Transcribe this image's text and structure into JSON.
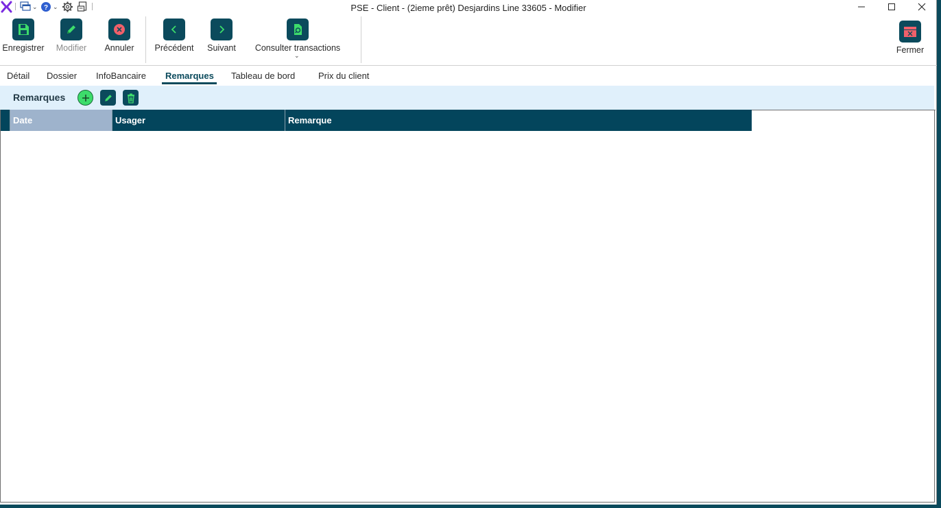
{
  "window": {
    "title": "PSE - Client - (2ieme prêt) Desjardins Line 33605 - Modifier"
  },
  "quick_access": {
    "icons": [
      "app-logo",
      "windows-icon",
      "help-icon",
      "gear-icon",
      "report-icon"
    ]
  },
  "ribbon": {
    "save": "Enregistrer",
    "modify": "Modifier",
    "cancel": "Annuler",
    "previous": "Précédent",
    "next": "Suivant",
    "consult": "Consulter transactions",
    "close": "Fermer"
  },
  "tabs": [
    {
      "label": "Détail"
    },
    {
      "label": "Dossier"
    },
    {
      "label": "InfoBancaire"
    },
    {
      "label": "Remarques",
      "active": true
    },
    {
      "label": "Tableau de bord"
    },
    {
      "label": "Prix du client"
    }
  ],
  "section": {
    "title": "Remarques"
  },
  "grid": {
    "columns": [
      "Date",
      "Usager",
      "Remarque"
    ],
    "selected_column": "Date",
    "rows": []
  },
  "colors": {
    "accent": "#0b4a5c",
    "header_bg": "#03455c",
    "section_bg": "#e0f0fb",
    "add_green": "#3ddc6b",
    "cancel_red": "#f0606a"
  }
}
